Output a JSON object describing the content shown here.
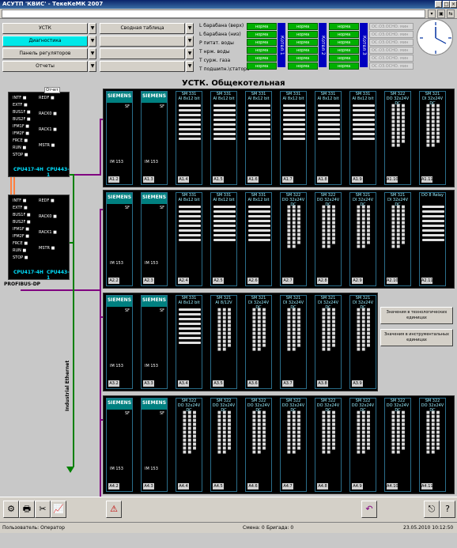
{
  "window": {
    "title": "АСУТП 'КВИС' - ТекеКеМК 2007"
  },
  "controls": {
    "left_buttons": [
      "УСТК",
      "Диагностика",
      "Панель регуляторов",
      "Отчеты"
    ],
    "summary_table": "Сводная таблица"
  },
  "params": {
    "labels": [
      "L барабана (верх)",
      "L барабана (низ)",
      "P питат. воды",
      "T нрж. воды",
      "T сурж. газа",
      "T подшипн.\\статора"
    ],
    "boilers": [
      "Котел 1",
      "Котел 2",
      "Котел 3"
    ],
    "status": "норма",
    "inactive": [
      "ОС.ОЗ.ОСНО. мин",
      "ОС.ОЗ.ОСНО. мин",
      "ОС.ОЗ.ОСНО. мин",
      "ОС.ОЗ.ОСНО. мин",
      "ОС.ОЗ.ОСНО. мин",
      "ОС.ОЗ.ОСНО. мин"
    ]
  },
  "main": {
    "title": "УСТК. Общекотельная",
    "cpu1": {
      "name": "CPU417-4H",
      "cpu443": "CPU443-1",
      "leds_left": [
        "INTF",
        "EXTF",
        "BUS1F",
        "BUS2F",
        "IFM1F",
        "IFM2F",
        "FRCE",
        "RUN",
        "STOP"
      ],
      "leds_right": [
        "REDF",
        "RACK0",
        "RACK1",
        "MSTR"
      ],
      "tag": "Отчет"
    },
    "cpu2": {
      "name": "CPU417-4H",
      "cpu443": "CPU443-1",
      "leds_left": [
        "INTF",
        "EXTF",
        "BUS1F",
        "BUS2F",
        "IFM1F",
        "IFM2F",
        "FRCE",
        "RUN",
        "STOP"
      ],
      "leds_right": [
        "REDF",
        "RACK0",
        "RACK1",
        "MSTR"
      ]
    },
    "profibus": "PROFIBUS-DP",
    "ethernet": "Industrial Ethernet",
    "rack1": [
      {
        "h": "SIEMENS",
        "slot": "A1.2"
      },
      {
        "h": "SIEMENS",
        "slot": "A1.3"
      },
      {
        "h": "SM 331",
        "sub": "AI 8x12 bit",
        "slot": "A1.4"
      },
      {
        "h": "SM 331",
        "sub": "AI 8x12 bit",
        "slot": "A1.5"
      },
      {
        "h": "SM 331",
        "sub": "AI 8x12 bit",
        "slot": "A1.6"
      },
      {
        "h": "SM 331",
        "sub": "AI 8x12 bit",
        "slot": "A1.7"
      },
      {
        "h": "SM 331",
        "sub": "AI 8x12 bit",
        "slot": "A1.8"
      },
      {
        "h": "SM 331",
        "sub": "AI 8x12 bit",
        "slot": "A1.9"
      },
      {
        "h": "SM 322",
        "sub": "DO 32x24V DC",
        "slot": "A1.10"
      },
      {
        "h": "SM 321",
        "sub": "DI 32x24V DC",
        "slot": "A1.11"
      }
    ],
    "rack2": [
      {
        "h": "SIEMENS",
        "slot": "A2.2"
      },
      {
        "h": "SIEMENS",
        "slot": "A2.3"
      },
      {
        "h": "SM 331",
        "sub": "AI 8x12 bit",
        "slot": "A2.4"
      },
      {
        "h": "SM 331",
        "sub": "AI 8x12 bit",
        "slot": "A2.5"
      },
      {
        "h": "SM 331",
        "sub": "AI 8x12 bit",
        "slot": "A2.6"
      },
      {
        "h": "SM 322",
        "sub": "DO 32x24V DC",
        "slot": "A2.7"
      },
      {
        "h": "SM 322",
        "sub": "DO 32x24V DC",
        "slot": "A2.8"
      },
      {
        "h": "SM 321",
        "sub": "DI 32x24V DC",
        "slot": "A2.9"
      },
      {
        "h": "SM 321",
        "sub": "DI 32x24V DC",
        "slot": "A2.10"
      },
      {
        "h": "DO 8 Relay",
        "sub": "",
        "slot": "A2.11"
      }
    ],
    "rack3": [
      {
        "h": "SIEMENS",
        "slot": "A3.2"
      },
      {
        "h": "SIEMENS",
        "slot": "A3.3"
      },
      {
        "h": "SM 331",
        "sub": "AI 8x12 bit",
        "slot": "A3.4"
      },
      {
        "h": "SM 321",
        "sub": "AI 8/12V",
        "slot": "A3.5"
      },
      {
        "h": "SM 321",
        "sub": "DI 32x24V DC",
        "slot": "A3.6"
      },
      {
        "h": "SM 321",
        "sub": "DI 32x24V DC",
        "slot": "A3.7"
      },
      {
        "h": "SM 321",
        "sub": "DI 32x24V DC",
        "slot": "A3.8"
      },
      {
        "h": "SM 321",
        "sub": "DI 32x24V DC",
        "slot": "A3.9"
      }
    ],
    "rack4": [
      {
        "h": "SIEMENS",
        "slot": "A4.2"
      },
      {
        "h": "SIEMENS",
        "slot": "A4.3"
      },
      {
        "h": "SM 322",
        "sub": "DO 32x24V DC",
        "slot": "A4.4"
      },
      {
        "h": "SM 322",
        "sub": "DO 32x24V DC",
        "slot": "A4.5"
      },
      {
        "h": "SM 322",
        "sub": "DO 32x24V DC",
        "slot": "A4.6"
      },
      {
        "h": "SM 322",
        "sub": "DO 32x24V DC",
        "slot": "A4.7"
      },
      {
        "h": "SM 322",
        "sub": "DO 32x24V DC",
        "slot": "A4.8"
      },
      {
        "h": "SM 322",
        "sub": "DO 32x24V DC",
        "slot": "A4.9"
      },
      {
        "h": "SM 322",
        "sub": "DO 32x24V DC",
        "slot": "A4.10"
      },
      {
        "h": "SM 322",
        "sub": "DO 32x24V DC",
        "slot": "A4.11"
      }
    ],
    "im": "IM 153",
    "sf": "SF",
    "side_buttons": [
      "Значения в технологических единицах",
      "Значения в инструментальных единицах"
    ]
  },
  "status": {
    "user": "Пользователь: Оператор",
    "shift": "Смена: 0",
    "brigade": "Бригада: 0",
    "datetime": "23.05.2010 10:12:50"
  },
  "colors": {
    "green": "#00b000",
    "blue": "#0000c0",
    "cyan": "#00e8e8",
    "siemens": "#008080"
  }
}
